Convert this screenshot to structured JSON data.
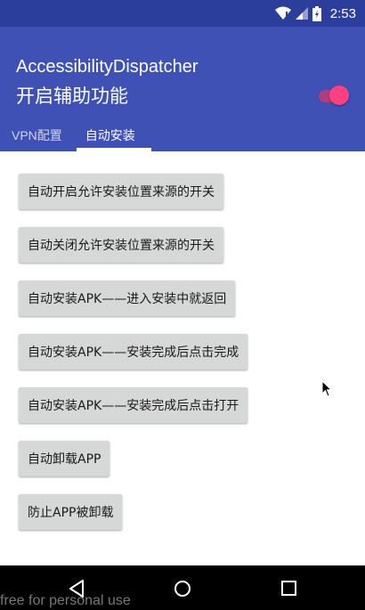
{
  "status_bar": {
    "time": "2:53"
  },
  "app_bar": {
    "app_name": "AccessibilityDispatcher",
    "subtitle": "开启辅助功能",
    "toggle_on": true
  },
  "tabs": [
    {
      "label": "VPN配置",
      "selected": false
    },
    {
      "label": "自动安装",
      "selected": true
    }
  ],
  "buttons": [
    "自动开启允许安装位置来源的开关",
    "自动关闭允许安装位置来源的开关",
    "自动安装APK——进入安装中就返回",
    "自动安装APK——安装完成后点击完成",
    "自动安装APK——安装完成后点击打开",
    "自动卸载APP",
    "防止APP被卸载"
  ],
  "watermark": "free for personal use",
  "colors": {
    "primary": "#3f51b5",
    "status_bar": "#2c3e9c",
    "accent": "#ff4081",
    "button": "#d6d7d7"
  }
}
